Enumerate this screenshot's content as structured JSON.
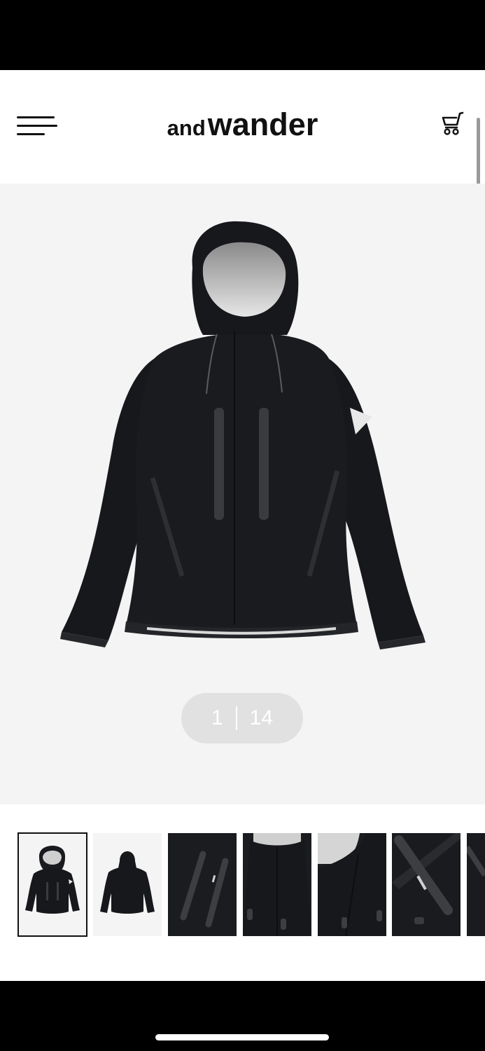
{
  "header": {
    "logo_small": "and",
    "logo_large": "wander",
    "menu_icon": "hamburger-menu-icon",
    "cart_icon": "shopping-cart-icon"
  },
  "gallery": {
    "current": "1",
    "total": "14",
    "selected_thumbnail": 1,
    "thumbnails": [
      "jacket-front",
      "jacket-back",
      "chest-zip-detail",
      "collar-detail",
      "hood-open-detail",
      "zip-pull-detail",
      "partial-thumbnail"
    ]
  },
  "colors": {
    "background": "#f4f4f4",
    "counter_pill": "#e1e1e1",
    "text": "#111111",
    "jacket": "#17181c"
  }
}
